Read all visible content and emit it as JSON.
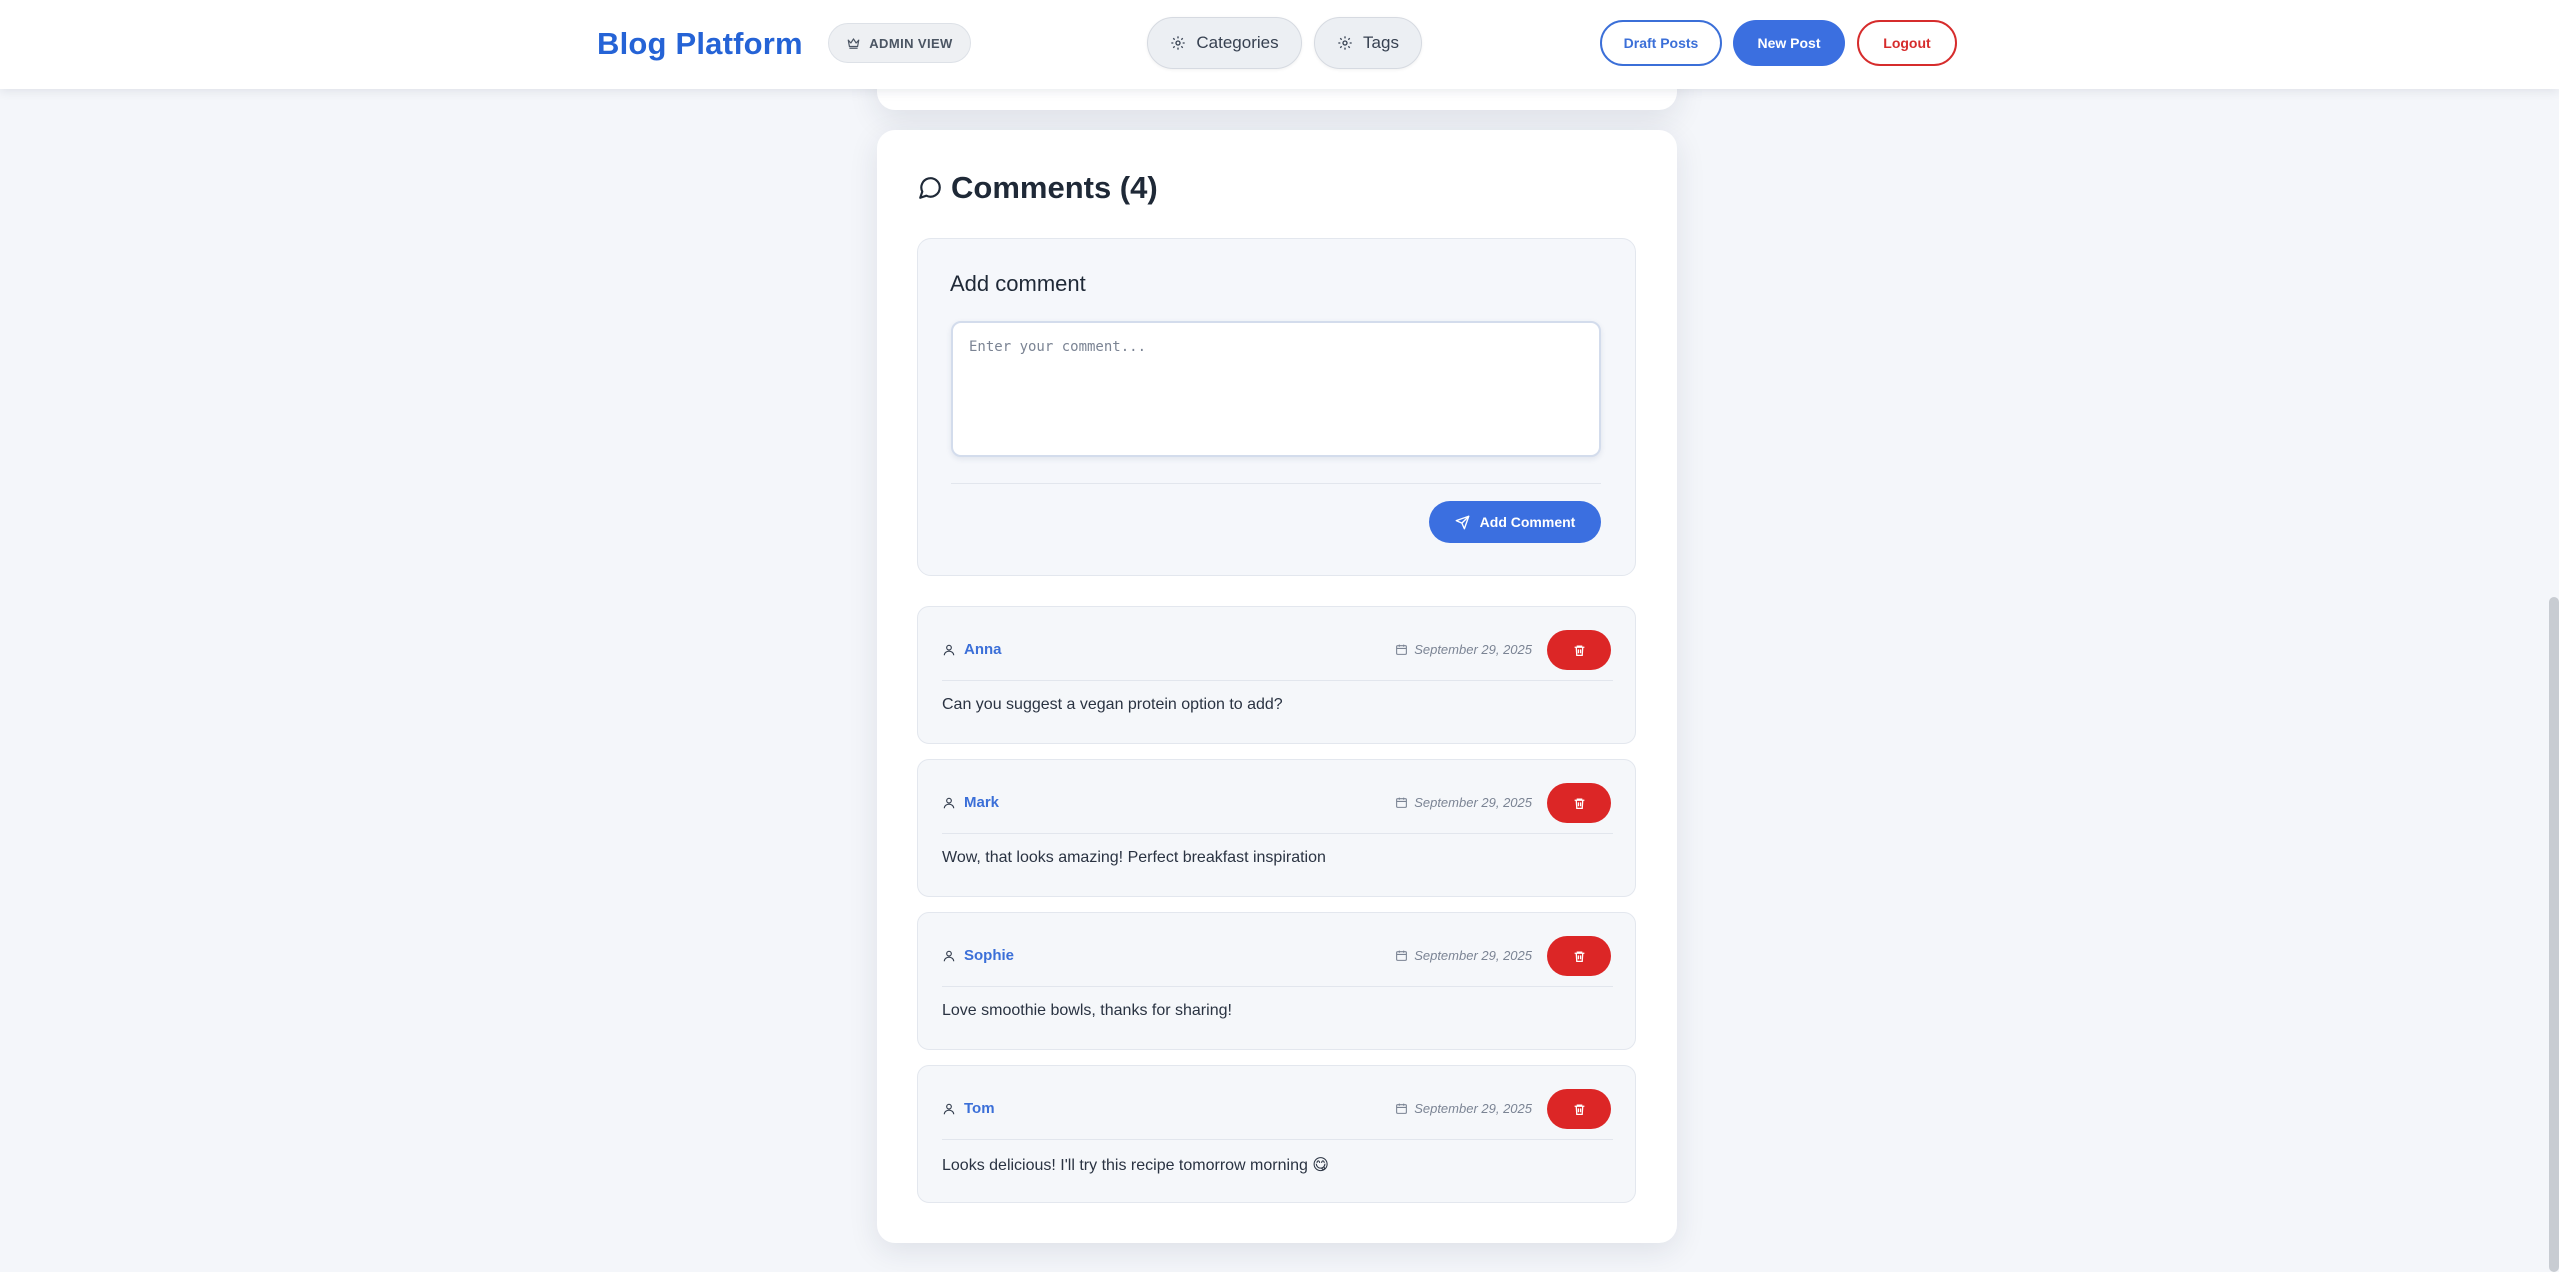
{
  "header": {
    "brand": "Blog Platform",
    "admin_badge": "ADMIN VIEW",
    "nav": [
      {
        "label": "Categories",
        "icon": "gear-icon"
      },
      {
        "label": "Tags",
        "icon": "gear-icon"
      }
    ],
    "draft_posts": "Draft Posts",
    "new_post": "New Post",
    "logout": "Logout"
  },
  "comments": {
    "title": "Comments (4)",
    "add_title": "Add comment",
    "input_placeholder": "Enter your comment...",
    "add_button": "Add Comment",
    "items": [
      {
        "author": "Anna",
        "date": "September 29, 2025",
        "text": "Can you suggest a vegan protein option to add?"
      },
      {
        "author": "Mark",
        "date": "September 29, 2025",
        "text": "Wow, that looks amazing! Perfect breakfast inspiration"
      },
      {
        "author": "Sophie",
        "date": "September 29, 2025",
        "text": "Love smoothie bowls, thanks for sharing!"
      },
      {
        "author": "Tom",
        "date": "September 29, 2025",
        "text": "Looks delicious! I'll try this recipe tomorrow morning 😋"
      }
    ]
  },
  "colors": {
    "accent": "#3b6fe0",
    "brand": "#2563d6",
    "danger": "#dc2626",
    "background": "#f4f6fa"
  }
}
